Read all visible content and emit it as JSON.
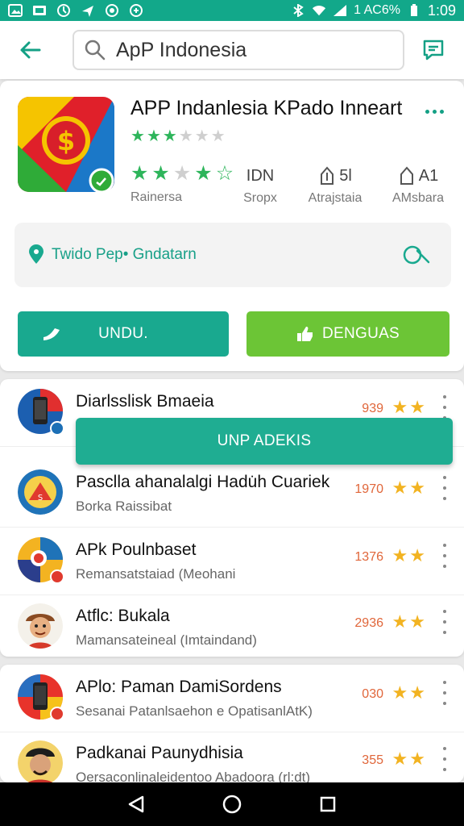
{
  "status_bar": {
    "battery": "1 AC6%",
    "time": "1:09"
  },
  "search": {
    "value": "ApP Indonesia"
  },
  "app": {
    "title": "APP Indanlesia KPado Inneart",
    "meta": [
      {
        "value": "",
        "label": "Rainersa"
      },
      {
        "value": "IDN",
        "label": "Sropx"
      },
      {
        "value": "5l",
        "label": "Atrajstaia"
      },
      {
        "value": "A1",
        "label": "AMsbara"
      }
    ],
    "info_text": "Twido Pep• Gndatarn",
    "download_label": "UNDU.",
    "ask_label": "DENGUAS"
  },
  "floating_button": "UNP ADEKIS",
  "list": [
    {
      "title": "Diarlsslisk Bmaeia",
      "subtitle": "",
      "count": "939"
    },
    {
      "title": "Pasclla ahanalalgi Hadu̇h Cuariek",
      "subtitle": "Borka Raissibat",
      "count": "1970"
    },
    {
      "title": "APk Poulnbaset",
      "subtitle": "Remansatstaiad (Meohani",
      "count": "1376"
    },
    {
      "title": "Atflc: Bukala",
      "subtitle": "Mamansateineal (Imtaindand)",
      "count": "2936"
    },
    {
      "title": "APlo: Paman DamiSordens",
      "subtitle": "Sesanai Patanlsaehon e OpatisanlAtK)",
      "count": "030"
    },
    {
      "title": "Padkanai Paunydhisia",
      "subtitle": "Oersaconlinaleidentoo Abadoora (rl:dt)",
      "count": "355"
    }
  ],
  "colors": {
    "accent": "#19a98f",
    "green_button": "#6cc536",
    "star_green": "#2eb55b",
    "star_gold": "#f2b321",
    "count_orange": "#e0663a"
  }
}
